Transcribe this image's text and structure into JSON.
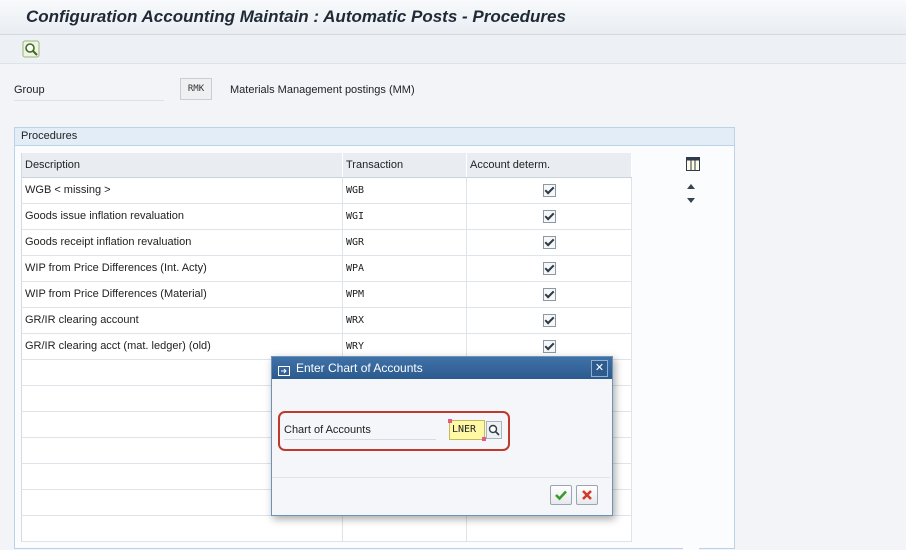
{
  "window": {
    "title": "Configuration Accounting Maintain : Automatic Posts - Procedures"
  },
  "toolbar": {
    "icons": [
      "magnifier-icon"
    ]
  },
  "group": {
    "label": "Group",
    "code": "RMK",
    "description": "Materials Management postings (MM)"
  },
  "procedures": {
    "header": "Procedures",
    "columns": [
      "Description",
      "Transaction",
      "Account determ."
    ],
    "rows": [
      {
        "description": "WGB < missing >",
        "transaction": "WGB",
        "account_determ": true
      },
      {
        "description": "Goods issue inflation revaluation",
        "transaction": "WGI",
        "account_determ": true
      },
      {
        "description": "Goods receipt inflation revaluation",
        "transaction": "WGR",
        "account_determ": true
      },
      {
        "description": "WIP from Price Differences (Int. Acty)",
        "transaction": "WPA",
        "account_determ": true
      },
      {
        "description": "WIP from Price Differences (Material)",
        "transaction": "WPM",
        "account_determ": true
      },
      {
        "description": "GR/IR clearing account",
        "transaction": "WRX",
        "account_determ": true
      },
      {
        "description": "GR/IR clearing acct (mat. ledger) (old)",
        "transaction": "WRY",
        "account_determ": true
      }
    ],
    "empty_rows": 8
  },
  "dialog": {
    "title": "Enter Chart of Accounts",
    "field_label": "Chart of Accounts",
    "field_value": "LNER",
    "close_symbol": "✕"
  },
  "colors": {
    "dialog_title_bar": "#2c5a8e",
    "highlight_border": "#c0392b",
    "input_bg": "#fff9a6",
    "ok_green": "#3c9a2f",
    "cancel_red": "#d23a2a"
  }
}
